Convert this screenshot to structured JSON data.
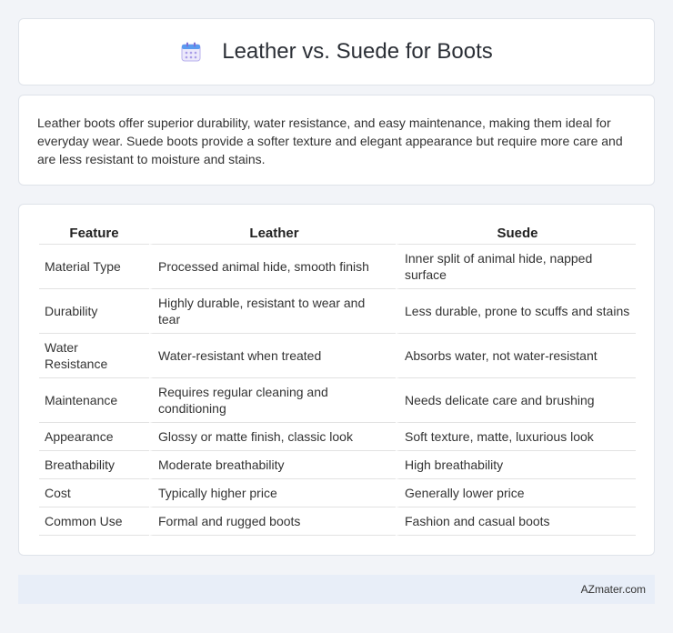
{
  "header": {
    "title": "Leather vs. Suede for Boots",
    "icon": "calendar-icon"
  },
  "intro": {
    "text": "Leather boots offer superior durability, water resistance, and easy maintenance, making them ideal for everyday wear. Suede boots provide a softer texture and elegant appearance but require more care and are less resistant to moisture and stains."
  },
  "table": {
    "headers": [
      "Feature",
      "Leather",
      "Suede"
    ],
    "rows": [
      [
        "Material Type",
        "Processed animal hide, smooth finish",
        "Inner split of animal hide, napped surface"
      ],
      [
        "Durability",
        "Highly durable, resistant to wear and tear",
        "Less durable, prone to scuffs and stains"
      ],
      [
        "Water Resistance",
        "Water-resistant when treated",
        "Absorbs water, not water-resistant"
      ],
      [
        "Maintenance",
        "Requires regular cleaning and conditioning",
        "Needs delicate care and brushing"
      ],
      [
        "Appearance",
        "Glossy or matte finish, classic look",
        "Soft texture, matte, luxurious look"
      ],
      [
        "Breathability",
        "Moderate breathability",
        "High breathability"
      ],
      [
        "Cost",
        "Typically higher price",
        "Generally lower price"
      ],
      [
        "Common Use",
        "Formal and rugged boots",
        "Fashion and casual boots"
      ]
    ]
  },
  "footer": {
    "text": "AZmater.com"
  },
  "colors": {
    "background": "#f2f4f8",
    "footer_bg": "#e8eef8",
    "icon_primary": "#7b6fd6",
    "icon_accent": "#5b9bf0"
  }
}
